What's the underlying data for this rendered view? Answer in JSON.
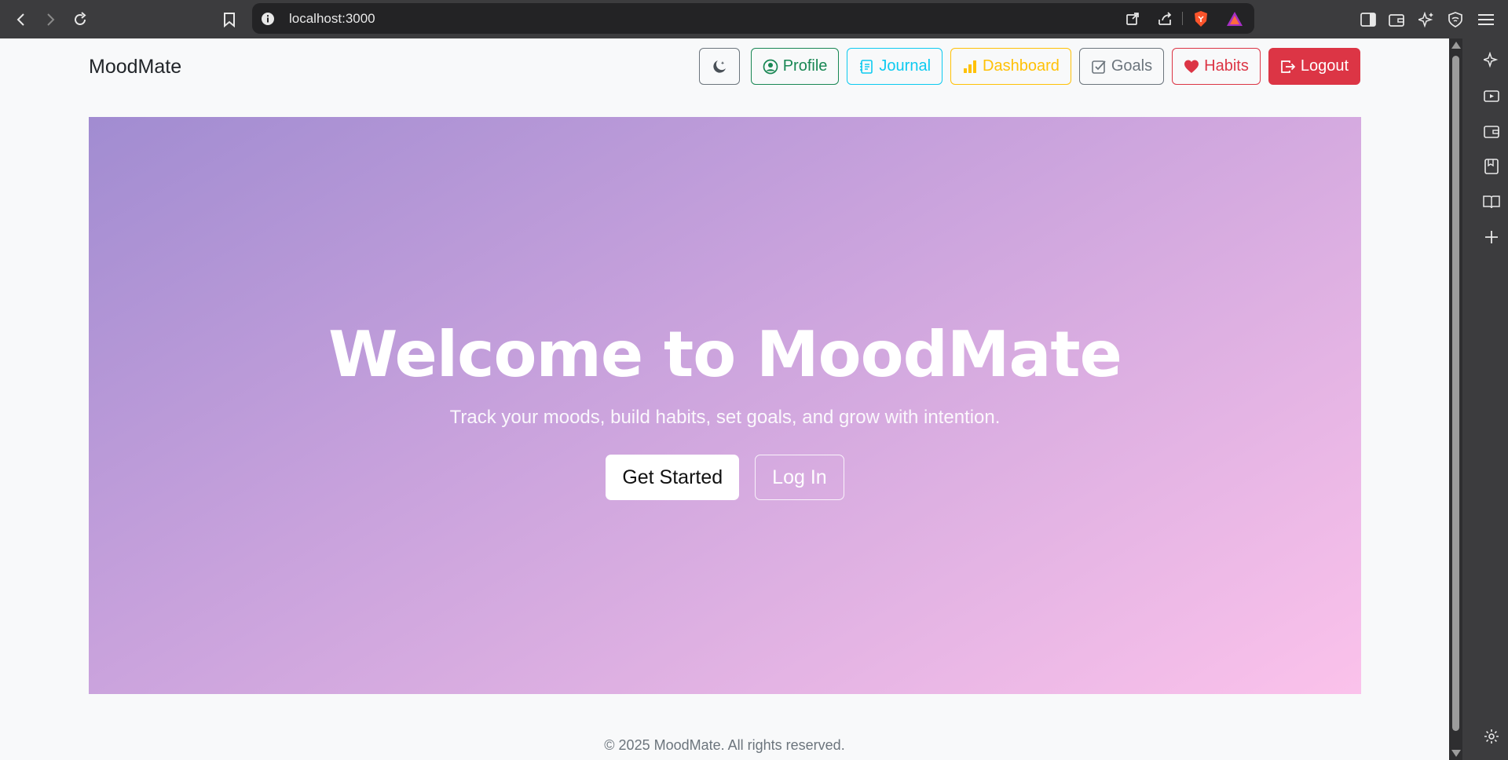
{
  "browser": {
    "url": "localhost:3000"
  },
  "app": {
    "brand": "MoodMate",
    "nav": {
      "profile": "Profile",
      "journal": "Journal",
      "dashboard": "Dashboard",
      "goals": "Goals",
      "habits": "Habits",
      "logout": "Logout"
    },
    "colors": {
      "profile": "#198754",
      "journal": "#0dcaf0",
      "dashboard": "#ffc107",
      "goals": "#6c757d",
      "habits": "#dc3545",
      "logout": "#dc3545"
    }
  },
  "hero": {
    "title": "Welcome to MoodMate",
    "subtitle": "Track your moods, build habits, set goals, and grow with intention.",
    "primary_cta": "Get Started",
    "secondary_cta": "Log In"
  },
  "footer": {
    "text": "© 2025 MoodMate. All rights reserved."
  }
}
